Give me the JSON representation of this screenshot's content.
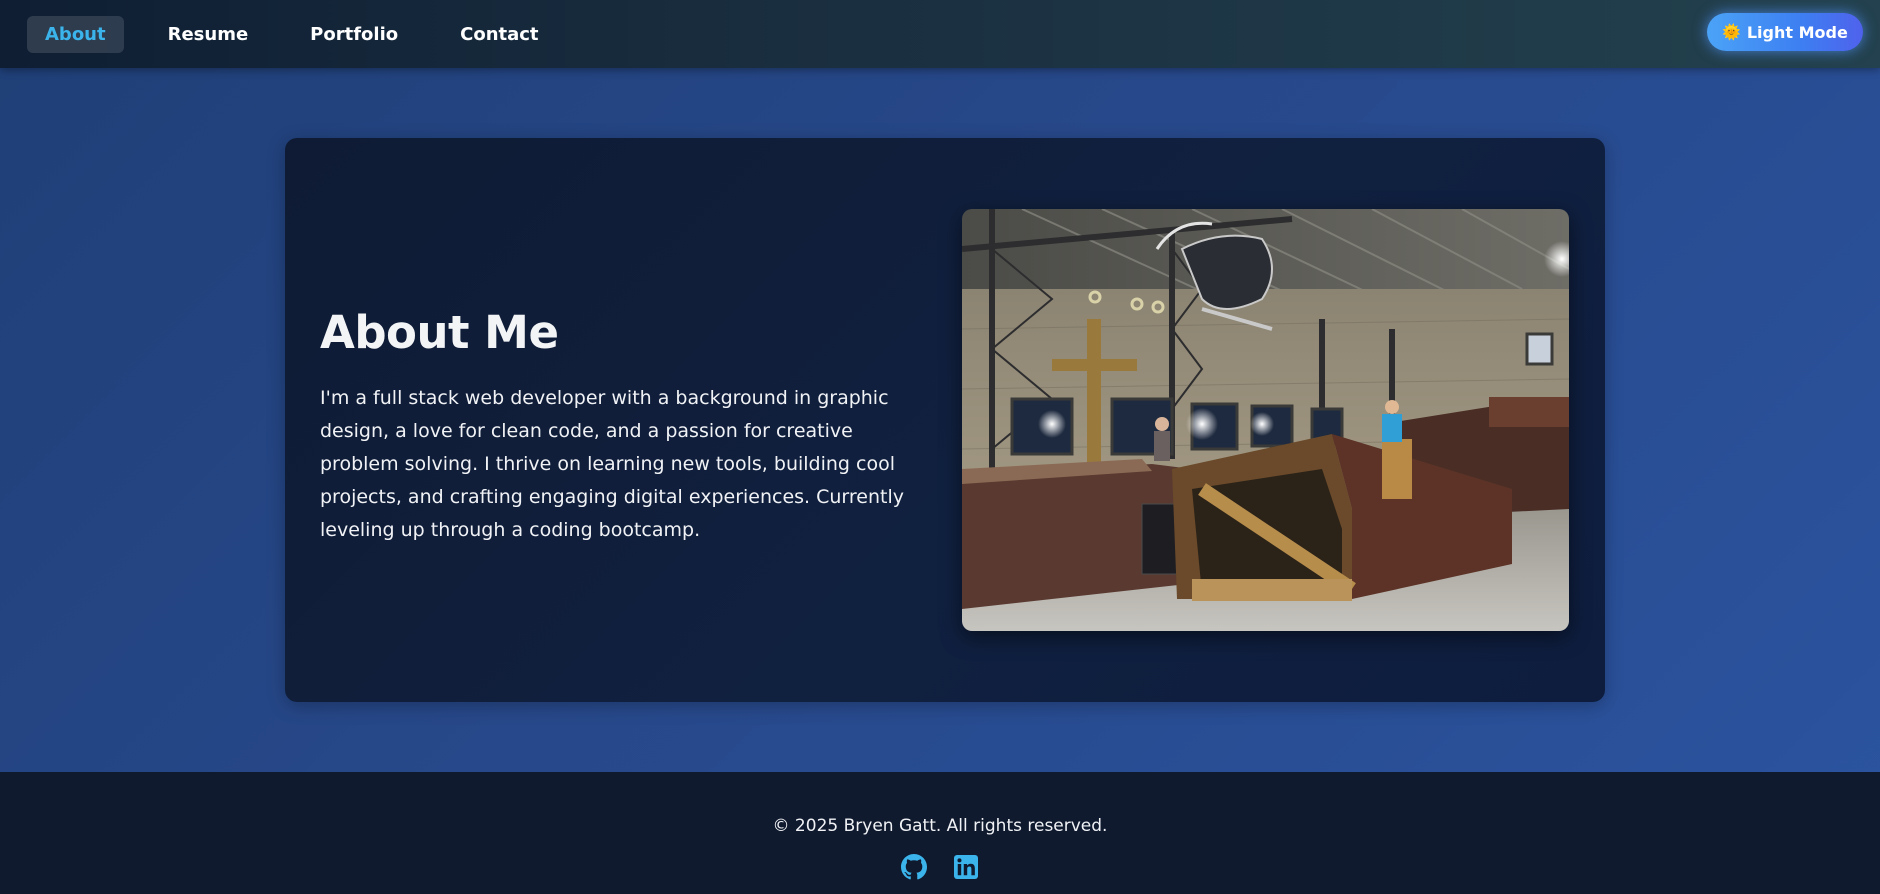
{
  "nav": {
    "items": [
      {
        "label": "About",
        "active": true
      },
      {
        "label": "Resume",
        "active": false
      },
      {
        "label": "Portfolio",
        "active": false
      },
      {
        "label": "Contact",
        "active": false
      }
    ],
    "theme_toggle": {
      "icon": "sun-emoji-icon",
      "icon_glyph": "🌞",
      "label": "Light Mode"
    }
  },
  "about": {
    "title": "About Me",
    "bio": "I'm a full stack web developer with a background in graphic design, a love for clean code, and a passion for creative problem solving. I thrive on learning new tools, building cool projects, and crafting engaging digital experiences. Currently leveling up through a coding bootcamp.",
    "photo": {
      "alt": "skatepark-photo"
    }
  },
  "footer": {
    "copyright": "© 2025 Bryen Gatt. All rights reserved.",
    "social": [
      {
        "icon": "github-icon"
      },
      {
        "icon": "linkedin-icon"
      }
    ]
  },
  "colors": {
    "accent": "#3bb4ec",
    "page_bg": "#27488a",
    "card_bg": "#10203f",
    "footer_bg": "#101a2f",
    "nav_bg": "#1a2f40",
    "button_gradient_start": "#4ba3f7",
    "button_gradient_end": "#4f62ec"
  }
}
